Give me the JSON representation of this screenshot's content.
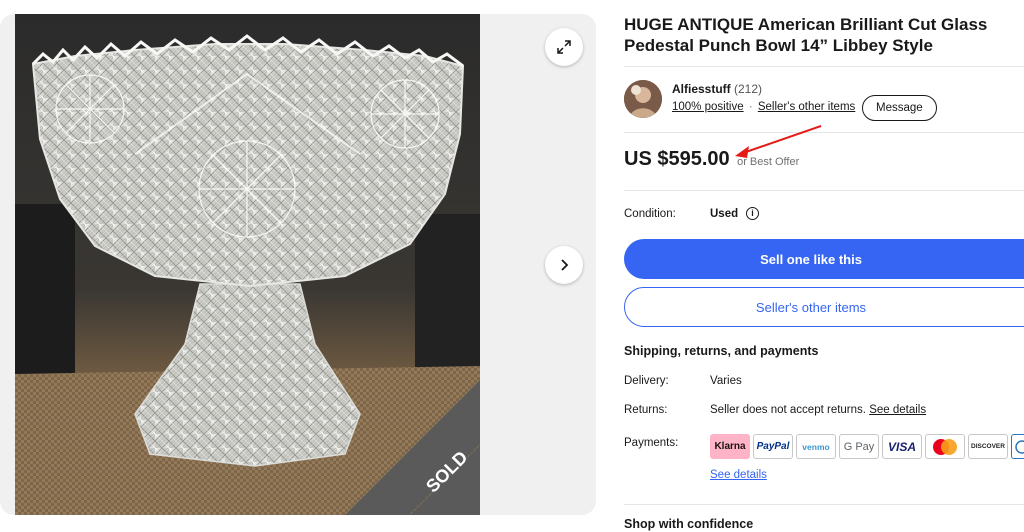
{
  "listing": {
    "title": "HUGE ANTIQUE American Brilliant Cut Glass Pedestal Punch Bowl 14” Libbey Style",
    "sold_banner": "SOLD"
  },
  "seller": {
    "name": "Alfiesstuff",
    "feedback_count": "(212)",
    "positive": "100% positive",
    "separator": "·",
    "other_items": "Seller's other items",
    "message_button": "Message"
  },
  "price": {
    "amount": "US $595.00",
    "offer_note": "or Best Offer"
  },
  "condition": {
    "label": "Condition:",
    "value": "Used",
    "info_icon": "i"
  },
  "actions": {
    "primary": "Sell one like this",
    "secondary": "Seller's other items"
  },
  "shipping": {
    "heading": "Shipping, returns, and payments",
    "delivery_label": "Delivery:",
    "delivery_value": "Varies",
    "returns_label": "Returns:",
    "returns_value": "Seller does not accept returns.",
    "returns_link": "See details",
    "payments_label": "Payments:",
    "payment_methods": [
      "Klarna",
      "PayPal",
      "venmo",
      "G Pay",
      "VISA",
      "Mastercard",
      "DISCOVER"
    ],
    "see_details": "See details"
  },
  "footer": {
    "shop_confidence": "Shop with confidence"
  },
  "icons": {
    "expand": "expand-icon",
    "next": "chevron-right-icon",
    "info": "info-icon"
  },
  "colors": {
    "primary_blue": "#3665f3",
    "sold_banner": "#5a5a5a",
    "annotation_arrow": "#e41b17"
  }
}
